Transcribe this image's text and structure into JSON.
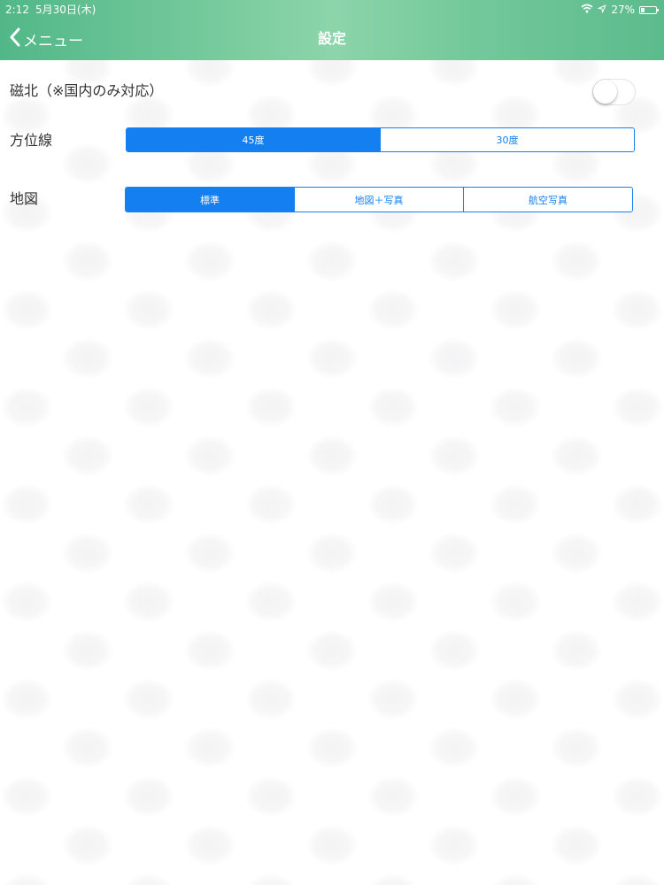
{
  "status_bar": {
    "time": "2:12",
    "date": "5月30日(木)",
    "battery_percent": "27%",
    "battery_level": 0.27
  },
  "nav": {
    "back_label": "メニュー",
    "title": "設定"
  },
  "settings": {
    "magnetic_north": {
      "label": "磁北（※国内のみ対応）",
      "enabled": false
    },
    "bearing_lines": {
      "label": "方位線",
      "options": [
        "45度",
        "30度"
      ],
      "selected_index": 0
    },
    "map": {
      "label": "地図",
      "options": [
        "標準",
        "地図＋写真",
        "航空写真"
      ],
      "selected_index": 0
    }
  },
  "colors": {
    "accent": "#137ff0",
    "header_green": "#6cc597"
  }
}
